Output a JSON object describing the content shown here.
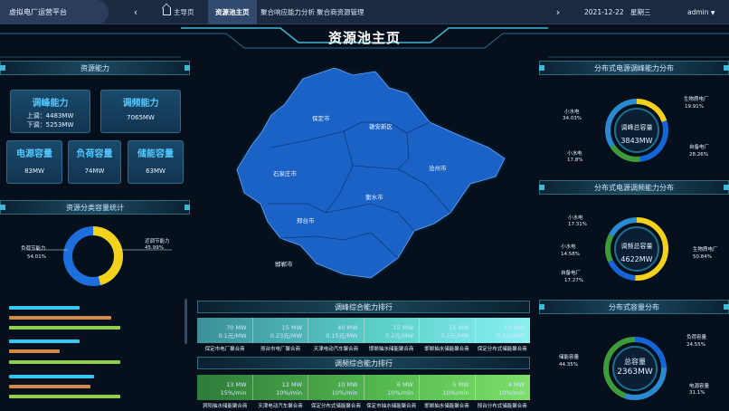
{
  "nav": {
    "brand": "虚拟电厂运营平台",
    "back_icon": "chevron-left-icon",
    "forward_icon": "chevron-right-icon",
    "items": [
      {
        "label": "主导页",
        "icon": "home-icon"
      },
      {
        "label": "资源池主页"
      },
      {
        "label": "聚合响应能力分析"
      },
      {
        "label": "聚合商资源管理"
      }
    ],
    "date": "2021-12-22",
    "weekday": "星期三",
    "user": "admin"
  },
  "page_title": "资源池主页",
  "resource_capacity": {
    "title": "资源能力",
    "peak": {
      "title": "调峰能力",
      "up": "上调：4483MW",
      "down": "下调：5253MW"
    },
    "fm": {
      "title": "调频能力",
      "value": "7065MW"
    },
    "power": {
      "title": "电源容量",
      "value": "83MW"
    },
    "load": {
      "title": "负荷容量",
      "value": "74MW"
    },
    "storage": {
      "title": "储能容量",
      "value": "63MW"
    }
  },
  "classification": {
    "title": "资源分类容量统计",
    "left_label": "负荷节能力",
    "left_value": "54.01%",
    "right_label": "近调节能力",
    "right_value": "45.99%",
    "chart_data": {
      "type": "pie",
      "categories": [
        "负荷节能力",
        "近调节能力"
      ],
      "values": [
        54.01,
        45.99
      ]
    },
    "bar_colors": [
      "#35c8f0",
      "#d28a4c",
      "#8ed04e",
      "#35c8f0",
      "#d28a4c",
      "#8ed04e",
      "#35c8f0",
      "#d28a4c",
      "#8ed04e"
    ],
    "bar_values": [
      0.62,
      0.9,
      0.98,
      0.62,
      0.45,
      0.98,
      0.75,
      0.72,
      0.98
    ]
  },
  "map": {
    "labels": [
      "保定市",
      "雄安新区",
      "沧州市",
      "石家庄市",
      "衡水市",
      "邢台市",
      "邯郸市"
    ]
  },
  "peak_rank": {
    "title": "调峰综合能力排行",
    "items": [
      {
        "mw": "70 MW",
        "price": "0.1元/MW",
        "name": "保定市电厂聚合商"
      },
      {
        "mw": "15 MW",
        "price": "0.23元/MW",
        "name": "邢台市电厂聚合商"
      },
      {
        "mw": "40 MW",
        "price": "0.15元/MW",
        "name": "天津电动汽车聚合商"
      },
      {
        "mw": "15 MW",
        "price": "0.2元/MW",
        "name": "邯郸抽水储能聚合商"
      },
      {
        "mw": "15 MW",
        "price": "0.1元/MW",
        "name": "邯郸抽水储能聚合商"
      },
      {
        "mw": "10 MW",
        "price": "0.5元/MW",
        "name": "保定分布式储能聚合商"
      }
    ]
  },
  "fm_rank": {
    "title": "调频综合能力排行",
    "items": [
      {
        "mw": "13 MW",
        "pct": "15%/min",
        "name": "洞阳抽水储能聚合商"
      },
      {
        "mw": "12 MW",
        "pct": "10%/min",
        "name": "天津电动汽车聚合商"
      },
      {
        "mw": "10 MW",
        "pct": "10%/min",
        "name": "保定分布式储能聚合商"
      },
      {
        "mw": "6 MW",
        "pct": "10%/min",
        "name": "保定市抽水储能聚合商"
      },
      {
        "mw": "5 MW",
        "pct": "10%/min",
        "name": "邯郸抽水储能聚合商"
      },
      {
        "mw": "4 MW",
        "pct": "10%/min",
        "name": "邢台分布式储能聚合商"
      }
    ]
  },
  "peak_dist": {
    "title": "分布式电源调峰能力分布",
    "center_label": "调峰总容量",
    "center_value": "3843MW",
    "labels": [
      {
        "name": "小水电",
        "pct": "34.03%"
      },
      {
        "name": "小水电",
        "pct": "17.8%"
      },
      {
        "name": "生物质电厂",
        "pct": "19.91%"
      },
      {
        "name": "自备电厂",
        "pct": "28.26%"
      }
    ],
    "chart_data": {
      "type": "pie",
      "categories": [
        "生物质电厂",
        "自备电厂",
        "小水电",
        "小水电"
      ],
      "values": [
        19.91,
        28.26,
        17.8,
        34.03
      ]
    }
  },
  "fm_dist": {
    "title": "分布式电源调频能力分布",
    "center_label": "调频总容量",
    "center_value": "4622MW",
    "labels": [
      {
        "name": "小水电",
        "pct": "17.31%"
      },
      {
        "name": "小水电",
        "pct": "14.58%"
      },
      {
        "name": "自备电厂",
        "pct": "17.27%"
      },
      {
        "name": "生物质电厂",
        "pct": "50.84%"
      }
    ],
    "chart_data": {
      "type": "pie",
      "categories": [
        "生物质电厂",
        "自备电厂",
        "小水电",
        "小水电"
      ],
      "values": [
        50.84,
        17.27,
        14.58,
        17.31
      ]
    }
  },
  "cap_dist": {
    "title": "分布式容量分布",
    "center_label": "总容量",
    "center_value": "2363MW",
    "labels": [
      {
        "name": "负荷容量",
        "pct": "24.55%"
      },
      {
        "name": "储能容量",
        "pct": "44.35%"
      },
      {
        "name": "电源容量",
        "pct": "31.1%"
      }
    ],
    "chart_data": {
      "type": "pie",
      "categories": [
        "负荷容量",
        "电源容量",
        "储能容量"
      ],
      "values": [
        24.55,
        31.1,
        44.35
      ]
    }
  },
  "colors": {
    "accent": "#52c8ff",
    "yellow": "#f2d21a",
    "blue": "#1565d8",
    "green": "#3f9a3a",
    "map": "#1a62c6"
  }
}
